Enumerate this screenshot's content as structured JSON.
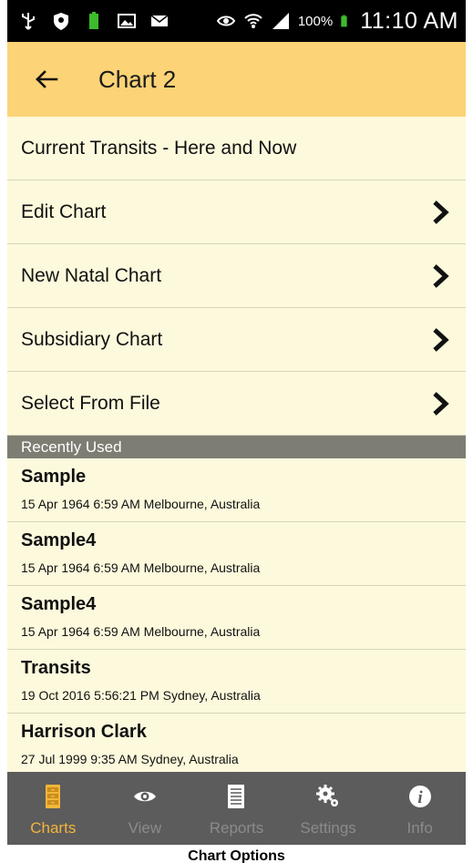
{
  "status_bar": {
    "battery_percent": "100%",
    "time": "11:10 AM",
    "icons": [
      "usb-icon",
      "shield-icon",
      "battery-mini-icon",
      "image-icon",
      "mail-icon",
      "eye-icon",
      "wifi-icon",
      "signal-icon",
      "battery-icon"
    ]
  },
  "toolbar": {
    "title": "Chart 2",
    "back_icon": "arrow-left-icon",
    "background": "#fcd376"
  },
  "menu": {
    "items": [
      {
        "label": "Current Transits - Here and Now",
        "has_chevron": false
      },
      {
        "label": "Edit Chart",
        "has_chevron": true
      },
      {
        "label": "New Natal Chart",
        "has_chevron": true
      },
      {
        "label": "Subsidiary Chart",
        "has_chevron": true
      },
      {
        "label": "Select From File",
        "has_chevron": true
      }
    ]
  },
  "recent": {
    "header": "Recently Used",
    "items": [
      {
        "name": "Sample",
        "detail": "15 Apr 1964 6:59 AM Melbourne, Australia"
      },
      {
        "name": "Sample4",
        "detail": "15 Apr 1964 6:59 AM Melbourne, Australia"
      },
      {
        "name": "Sample4",
        "detail": "15 Apr 1964 6:59 AM Melbourne, Australia"
      },
      {
        "name": "Transits",
        "detail": "19 Oct 2016 5:56:21 PM Sydney, Australia"
      },
      {
        "name": "Harrison Clark",
        "detail": "27 Jul 1999 9:35 AM Sydney, Australia"
      }
    ]
  },
  "bottom_nav": {
    "items": [
      {
        "label": "Charts",
        "icon": "file-cabinet-icon",
        "active": true
      },
      {
        "label": "View",
        "icon": "eye-icon",
        "active": false
      },
      {
        "label": "Reports",
        "icon": "document-icon",
        "active": false
      },
      {
        "label": "Settings",
        "icon": "gears-icon",
        "active": false
      },
      {
        "label": "Info",
        "icon": "info-icon",
        "active": false
      }
    ],
    "active_color": "#f2b63a",
    "inactive_color": "#8b8b8b"
  },
  "caption": "Chart Options"
}
